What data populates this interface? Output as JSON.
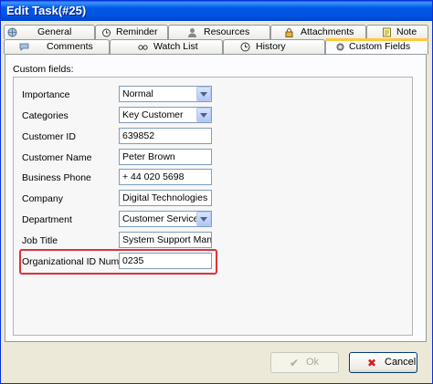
{
  "window": {
    "title": "Edit Task(#25)"
  },
  "tabs_row1": [
    {
      "label": "General"
    },
    {
      "label": "Reminder"
    },
    {
      "label": "Resources"
    },
    {
      "label": "Attachments"
    },
    {
      "label": "Note"
    }
  ],
  "tabs_row2": [
    {
      "label": "Comments"
    },
    {
      "label": "Watch List"
    },
    {
      "label": "History"
    },
    {
      "label": "Custom Fields",
      "active": true
    }
  ],
  "custom_fields": {
    "section_label": "Custom fields:",
    "fields": [
      {
        "label": "Importance",
        "value": "Normal",
        "type": "dropdown"
      },
      {
        "label": "Categories",
        "value": "Key Customer",
        "type": "dropdown"
      },
      {
        "label": "Customer ID",
        "value": "639852",
        "type": "text"
      },
      {
        "label": "Customer Name",
        "value": "Peter Brown",
        "type": "text"
      },
      {
        "label": "Business Phone",
        "value": "+ 44 020 5698",
        "type": "text"
      },
      {
        "label": "Company",
        "value": "Digital Technologies",
        "type": "text"
      },
      {
        "label": "Department",
        "value": "Customer Service",
        "type": "dropdown"
      },
      {
        "label": "Job Title",
        "value": "System Support Manag",
        "type": "text"
      },
      {
        "label": "Organizational ID Number",
        "value": "0235",
        "type": "text",
        "highlighted": true
      }
    ]
  },
  "buttons": {
    "ok": {
      "label": "Ok",
      "enabled": false
    },
    "cancel": {
      "label": "Cancel",
      "enabled": true
    }
  },
  "colors": {
    "title_bar": "#0054E3",
    "highlight_border": "#E0303A",
    "active_tab_accent": "#FFC83C"
  }
}
